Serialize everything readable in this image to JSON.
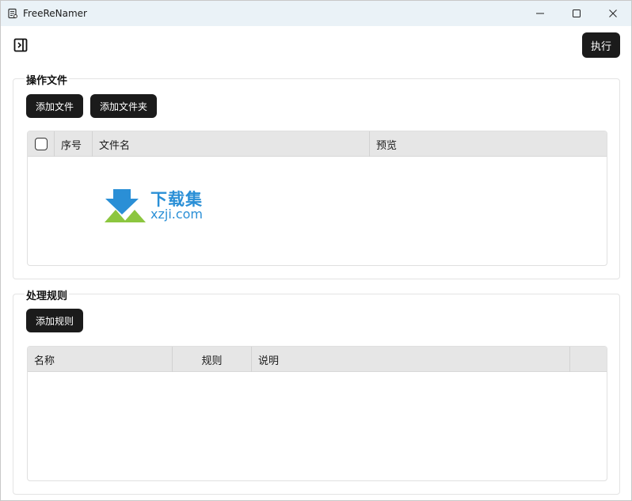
{
  "window": {
    "title": "FreeReNamer",
    "controls": [
      "minimize-icon",
      "maximize-icon",
      "close-icon"
    ]
  },
  "toolbar": {
    "sidebar_toggle_icon": "sidebar-toggle-icon",
    "run_label": "执行"
  },
  "files_section": {
    "title": "操作文件",
    "add_file_label": "添加文件",
    "add_folder_label": "添加文件夹",
    "table": {
      "columns": [
        "序号",
        "文件名",
        "预览"
      ],
      "rows": []
    }
  },
  "rules_section": {
    "title": "处理规则",
    "add_rule_label": "添加规则",
    "table": {
      "columns": [
        "名称",
        "规则",
        "说明",
        ""
      ],
      "rows": []
    }
  },
  "watermark": {
    "title": "下载集",
    "url": "xzji.com"
  },
  "colors": {
    "titlebar_bg": "#eaf2f7",
    "button_bg": "#1b1b1b",
    "header_bg": "#e6e6e6",
    "watermark_blue": "#2a8fd6",
    "watermark_green": "#8cc63f"
  }
}
